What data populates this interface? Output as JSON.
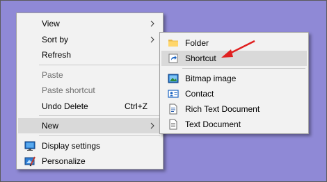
{
  "main_menu": {
    "items": [
      {
        "label": "View"
      },
      {
        "label": "Sort by"
      },
      {
        "label": "Refresh"
      },
      {
        "label": "Paste"
      },
      {
        "label": "Paste shortcut"
      },
      {
        "label": "Undo Delete",
        "shortcut": "Ctrl+Z"
      },
      {
        "label": "New"
      },
      {
        "label": "Display settings"
      },
      {
        "label": "Personalize"
      }
    ]
  },
  "new_submenu": {
    "items": [
      {
        "label": "Folder"
      },
      {
        "label": "Shortcut"
      },
      {
        "label": "Bitmap image"
      },
      {
        "label": "Contact"
      },
      {
        "label": "Rich Text Document"
      },
      {
        "label": "Text Document"
      }
    ]
  },
  "colors": {
    "desktop": "#8f89d6",
    "menu_bg": "#f2f2f2",
    "highlight": "#d9d9d9",
    "annotation_arrow": "#e02020"
  },
  "icons": [
    "chevron-right-icon",
    "display-settings-icon",
    "personalize-icon",
    "folder-icon",
    "shortcut-icon",
    "bitmap-image-icon",
    "contact-icon",
    "rich-text-document-icon",
    "text-document-icon"
  ]
}
